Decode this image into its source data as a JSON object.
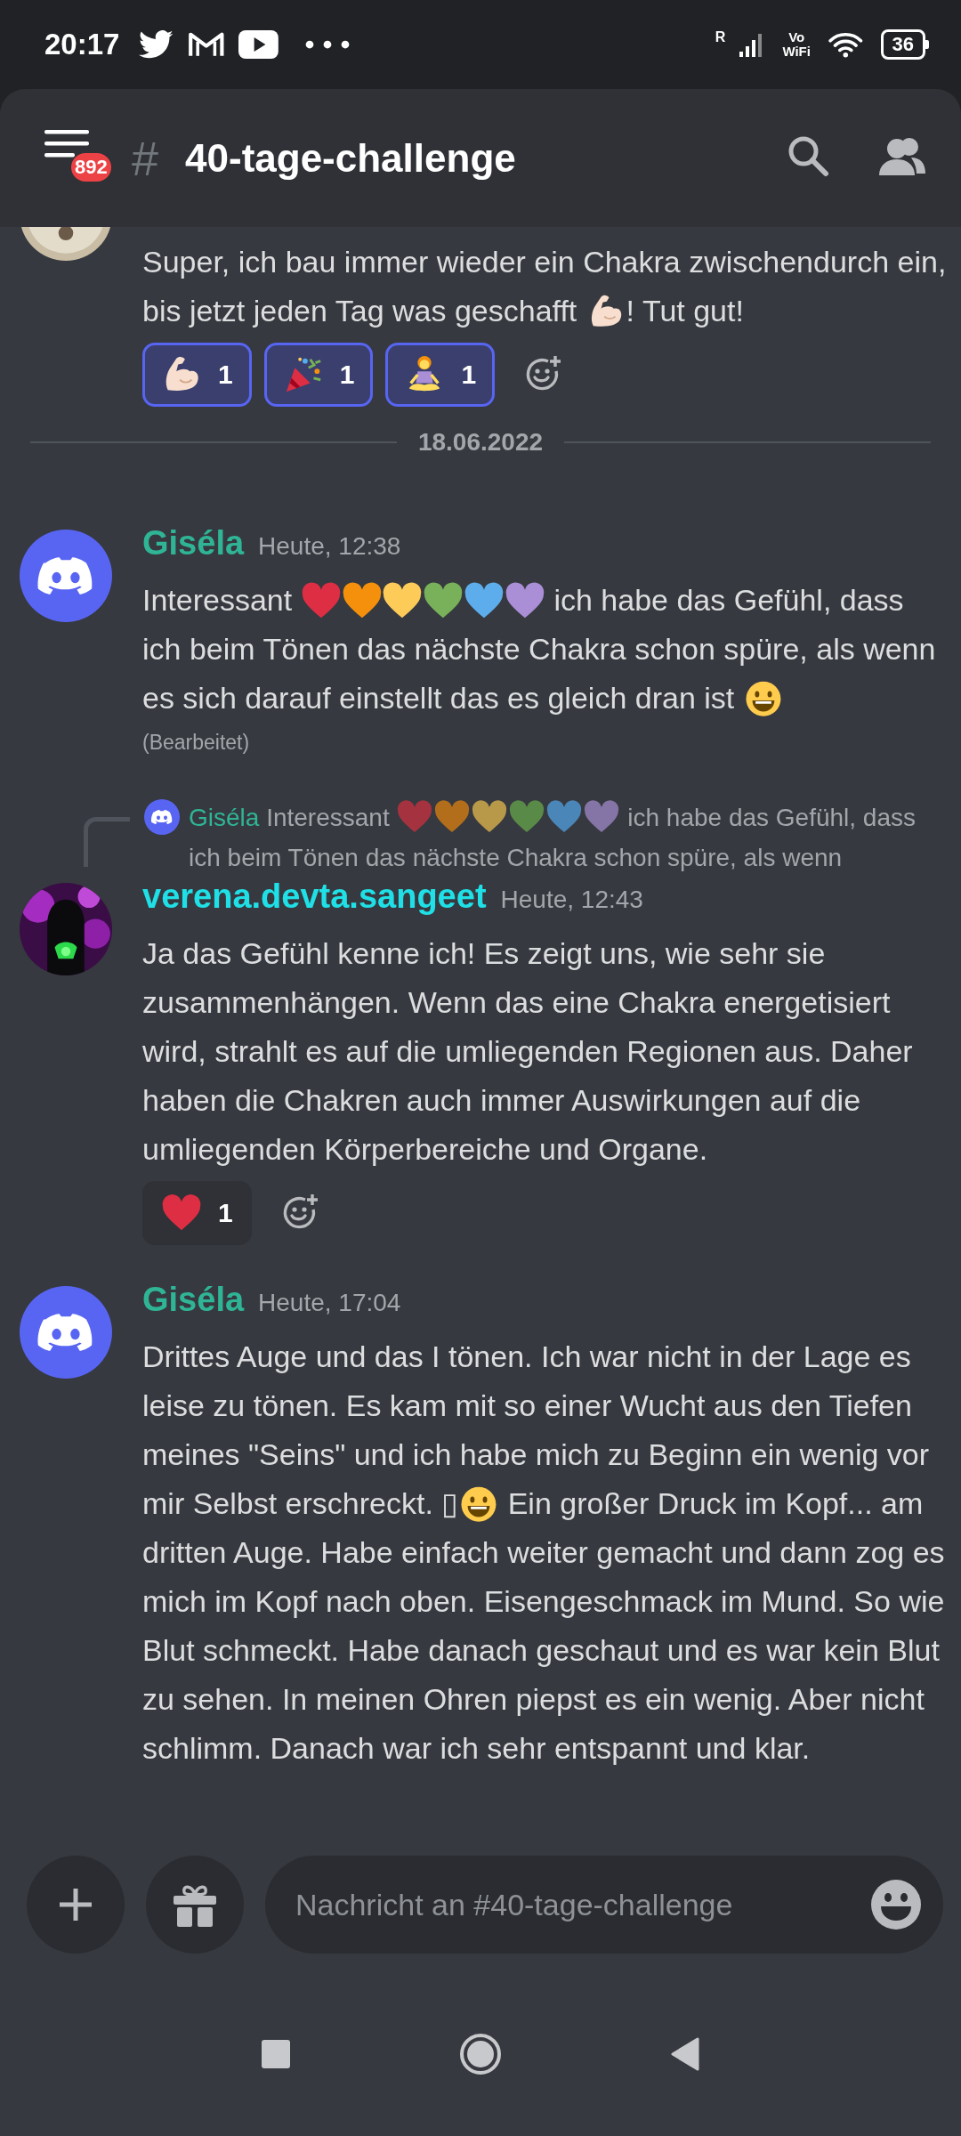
{
  "status_bar": {
    "time": "20:17",
    "signal_label": "R",
    "vowifi": [
      "Vo",
      "WiFi"
    ],
    "battery": "36"
  },
  "header": {
    "badge": "892",
    "hash": "#",
    "channel": "40-tage-challenge"
  },
  "feed": [
    {
      "kind": "message",
      "avatar": {
        "kind": "picture"
      },
      "body": [
        {
          "kind": "text",
          "text": "Super, ich bau immer wieder ein Chakra zwischendurch ein, bis jetzt jeden Tag was geschafft "
        },
        {
          "kind": "muscle"
        },
        {
          "kind": "text",
          "text": "! Tut gut!"
        }
      ],
      "reactions": [
        {
          "kind": "muscle",
          "count": "1",
          "selected": true
        },
        {
          "kind": "party",
          "count": "1",
          "selected": true
        },
        {
          "kind": "meditate",
          "count": "1",
          "selected": true
        }
      ]
    },
    {
      "kind": "divider",
      "date": "18.06.2022"
    },
    {
      "kind": "message",
      "avatar": {
        "kind": "logo"
      },
      "author": "Giséla",
      "color": "#2fb595",
      "time": "Heute, 12:38",
      "body": [
        {
          "kind": "text",
          "text": "Interessant "
        },
        {
          "kind": "heart",
          "color": "#dd2e44"
        },
        {
          "kind": "heart",
          "color": "#f4900c"
        },
        {
          "kind": "heart",
          "color": "#fdcb58"
        },
        {
          "kind": "heart",
          "color": "#78b159"
        },
        {
          "kind": "heart",
          "color": "#5dadec"
        },
        {
          "kind": "heart",
          "color": "#aa8ed6"
        },
        {
          "kind": "text",
          "text": " ich habe das Gefühl, dass ich beim Tönen das nächste Chakra schon spüre, als wenn es sich darauf einstellt das es gleich dran ist "
        },
        {
          "kind": "grin"
        }
      ],
      "edited": "(Bearbeitet)"
    },
    {
      "kind": "message",
      "avatar": {
        "kind": "picture"
      },
      "author": "verena.devta.sangeet",
      "color": "#1fe0e6",
      "time": "Heute, 12:43",
      "reply": {
        "author": "Giséla",
        "color": "#2fb595",
        "body": [
          {
            "kind": "text",
            "text": "Interessant "
          },
          {
            "kind": "heart",
            "color": "#a5323f"
          },
          {
            "kind": "heart",
            "color": "#b36e1c"
          },
          {
            "kind": "heart",
            "color": "#b8994a"
          },
          {
            "kind": "heart",
            "color": "#5a8a48"
          },
          {
            "kind": "heart",
            "color": "#4a86b8"
          },
          {
            "kind": "heart",
            "color": "#8574a6"
          },
          {
            "kind": "text",
            "text": " ich habe das Gefühl, dass ich beim Tönen das nächste Chakra schon spüre, als wenn"
          }
        ]
      },
      "body": [
        {
          "kind": "text",
          "text": "Ja das Gefühl kenne ich! Es zeigt uns, wie sehr sie zusammenhängen. Wenn das eine Chakra energetisiert wird, strahlt es auf die umliegenden Regionen aus. Daher haben die Chakren auch immer Auswirkungen auf die umliegenden Körperbereiche und Organe."
        }
      ],
      "reactions": [
        {
          "kind": "heart",
          "count": "1",
          "selected": false
        }
      ]
    },
    {
      "kind": "message",
      "avatar": {
        "kind": "logo"
      },
      "author": "Giséla",
      "color": "#2fb595",
      "time": "Heute, 17:04",
      "body": [
        {
          "kind": "text",
          "text": "Drittes Auge und das I tönen. Ich war nicht in der  Lage es leise zu tönen. Es kam mit so einer Wucht aus den Tiefen meines \"Seins\" und ich habe mich zu Beginn ein wenig vor mir Selbst erschreckt. ▯"
        },
        {
          "kind": "grin"
        },
        {
          "kind": "text",
          "text": " Ein großer Druck im Kopf... am dritten Auge. Habe einfach weiter gemacht und dann zog es mich im Kopf nach oben. Eisengeschmack im Mund. So wie Blut schmeckt. Habe danach geschaut und es war kein Blut zu sehen. In meinen Ohren piepst es ein wenig. Aber nicht schlimm. Danach war ich sehr entspannt und klar."
        }
      ]
    }
  ],
  "composer": {
    "placeholder": "Nachricht an #40-tage-challenge"
  }
}
